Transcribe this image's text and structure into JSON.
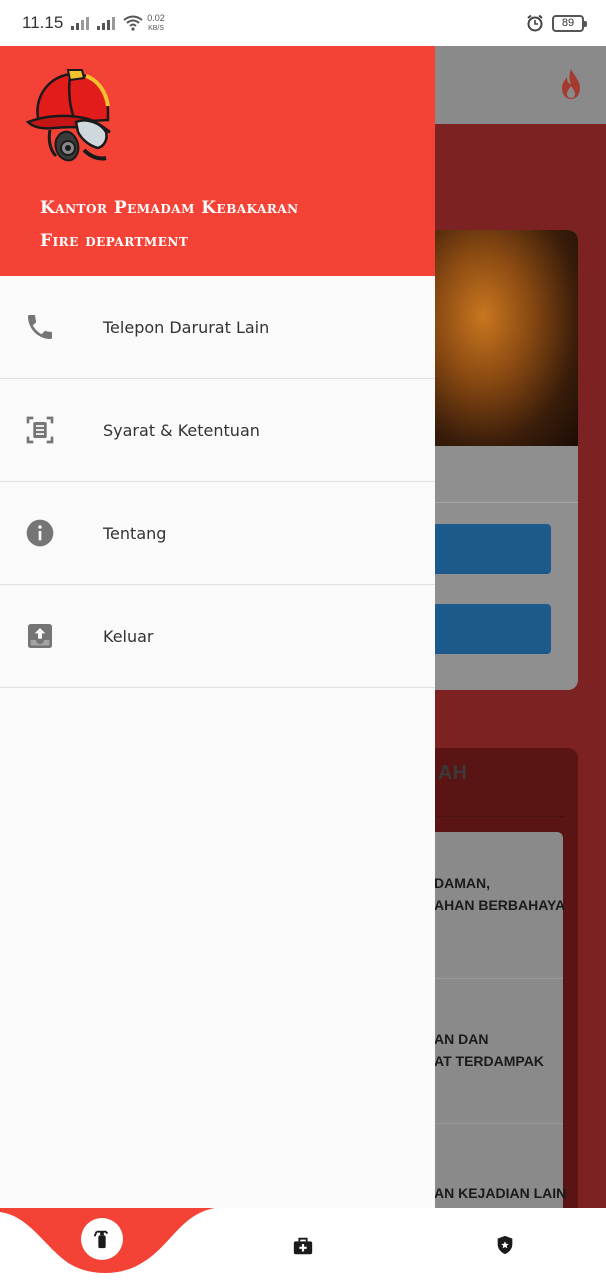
{
  "status_bar": {
    "time": "11.15",
    "net_speed_value": "0.02",
    "net_speed_unit": "KB/S",
    "battery": "89"
  },
  "drawer": {
    "title_line1": "Kantor Pemadam Kebakaran",
    "title_line2": "Fire department",
    "menu": [
      {
        "label": "Telepon Darurat Lain",
        "icon": "phone-icon"
      },
      {
        "label": "Syarat & Ketentuan",
        "icon": "document-scan-icon"
      },
      {
        "label": "Tentang",
        "icon": "info-icon"
      },
      {
        "label": "Keluar",
        "icon": "logout-tray-icon"
      }
    ]
  },
  "background": {
    "card2_title": "AH",
    "items": [
      {
        "line1": "DAMAN,",
        "line2": "AHAN BERBAHAYA"
      },
      {
        "line1": "AN DAN",
        "line2": "AT TERDAMPAK"
      },
      {
        "line1": "AN KEJADIAN LAIN",
        "line2": ""
      }
    ]
  },
  "bottom_nav": {
    "items": [
      "fire-extinguisher-icon",
      "medical-kit-icon",
      "shield-icon"
    ]
  },
  "colors": {
    "header_red": "#f44336",
    "drawer_bg": "#fafafa",
    "icon_gray": "#757575"
  }
}
